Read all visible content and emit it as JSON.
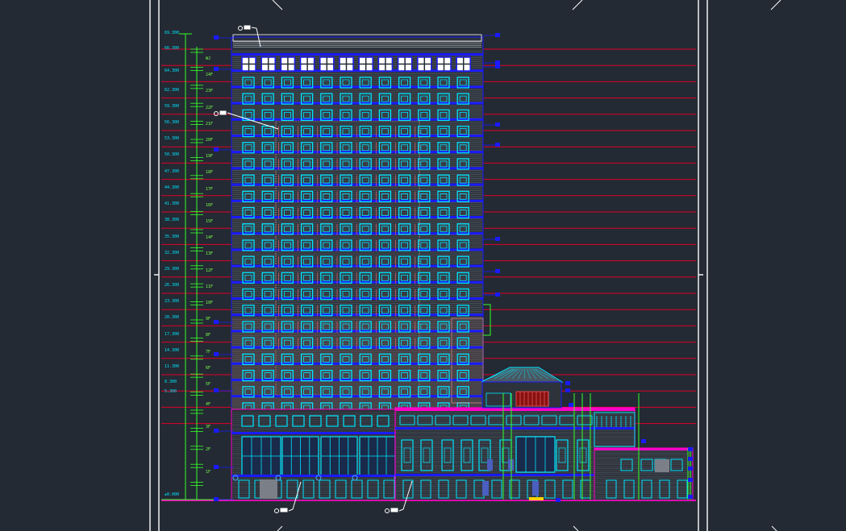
{
  "app": {
    "background": "#232a33",
    "accent_cyan": "#00e5ff",
    "accent_red": "#e0002a",
    "accent_blue": "#1a1aff",
    "accent_green": "#35ff2a",
    "accent_magenta": "#ff00c8"
  },
  "drawing": {
    "elevation_marks": [
      "69.300",
      "66.300",
      "64.300",
      "62.300",
      "59.300",
      "56.300",
      "53.300",
      "50.300",
      "47.300",
      "44.300",
      "41.300",
      "38.300",
      "35.300",
      "32.300",
      "29.300",
      "26.300",
      "23.300",
      "20.300",
      "17.300",
      "14.300",
      "11.300",
      "8.300",
      "5.300",
      "±0.000"
    ],
    "floor_labels": [
      "WJ",
      "24F",
      "23F",
      "22F",
      "21F",
      "20F",
      "19F",
      "18F",
      "17F",
      "16F",
      "15F",
      "14F",
      "13F",
      "12F",
      "11F",
      "10F",
      "9F",
      "8F",
      "7F",
      "6F",
      "5F",
      "4F",
      "3F",
      "2F",
      "1F"
    ],
    "icons": [
      "pan-handle-icon",
      "grid-axis-icon",
      "section-mark-icon"
    ]
  }
}
